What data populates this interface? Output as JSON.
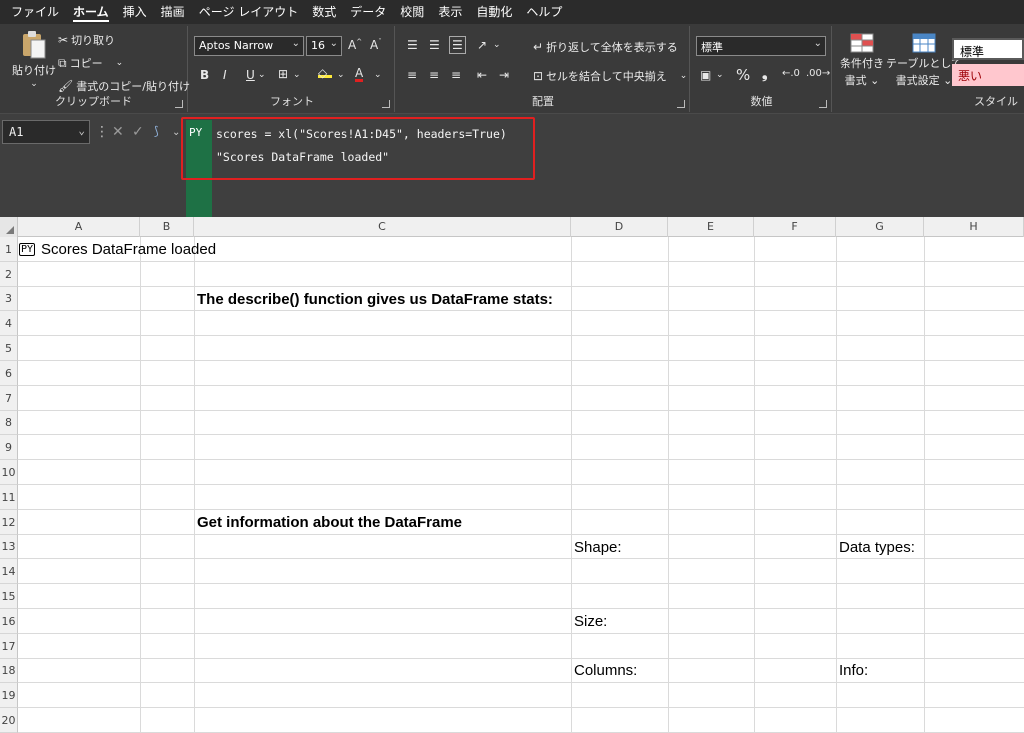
{
  "menu_tabs": [
    "ファイル",
    "ホーム",
    "挿入",
    "描画",
    "ページ レイアウト",
    "数式",
    "データ",
    "校閲",
    "表示",
    "自動化",
    "ヘルプ"
  ],
  "active_tab": "ホーム",
  "ribbon": {
    "clipboard": {
      "paste_label": "貼り付け",
      "cut_label": "切り取り",
      "copy_label": "コピー",
      "format_painter_label": "書式のコピー/貼り付け",
      "group_label": "クリップボード"
    },
    "font": {
      "font_name": "Aptos Narrow",
      "font_size": "16",
      "bold": "B",
      "italic": "I",
      "underline": "U",
      "group_label": "フォント"
    },
    "alignment": {
      "wrap_text_label": "折り返して全体を表示する",
      "merge_center_label": "セルを結合して中央揃え",
      "group_label": "配置"
    },
    "number": {
      "format_value": "標準",
      "percent": "%",
      "comma": "❟",
      "group_label": "数値"
    },
    "styles": {
      "conditional_formatting_line1": "条件付き",
      "conditional_formatting_line2": "書式",
      "format_as_table_line1": "テーブルとして",
      "format_as_table_line2": "書式設定",
      "style_normal": "標準",
      "style_bad": "悪い",
      "group_label": "スタイル"
    }
  },
  "formula_bar": {
    "name_box": "A1",
    "py_badge": "PY",
    "code_lines": [
      "scores = xl(\"Scores!A1:D45\", headers=True)",
      "\"Scores DataFrame loaded\""
    ]
  },
  "columns": [
    "A",
    "B",
    "C",
    "D",
    "E",
    "F",
    "G",
    "H"
  ],
  "rows": [
    "1",
    "2",
    "3",
    "4",
    "5",
    "6",
    "7",
    "8",
    "9",
    "10",
    "11",
    "12",
    "13",
    "14",
    "15",
    "16",
    "17",
    "18",
    "19",
    "20"
  ],
  "cells": {
    "A1": "Scores DataFrame loaded",
    "A1_py_icon": "PY",
    "C3": "The describe() function gives us DataFrame stats:",
    "C12": "Get information about the DataFrame",
    "D13": "Shape:",
    "G13": "Data types:",
    "D16": "Size:",
    "D18": "Columns:",
    "G18": "Info:"
  },
  "colors": {
    "ribbon_bg": "#3a3a3a",
    "python_green": "#1e7145",
    "highlight_red": "#e02020",
    "bad_style_text": "#9c0006",
    "bad_style_bg": "#ffc7ce"
  }
}
